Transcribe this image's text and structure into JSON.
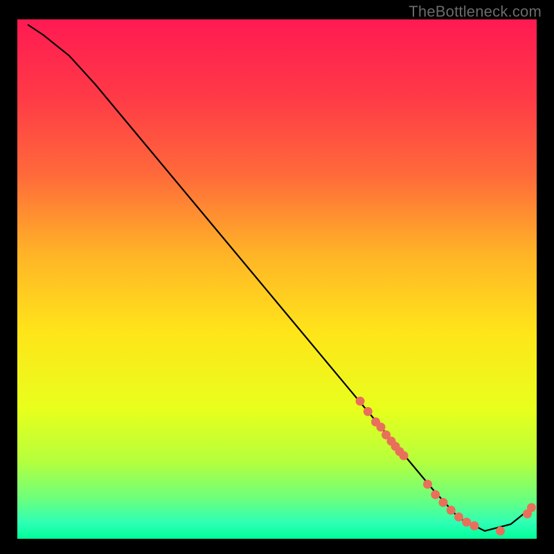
{
  "watermark": "TheBottleneck.com",
  "chart_data": {
    "type": "line",
    "title": "",
    "xlabel": "",
    "ylabel": "",
    "xlim": [
      0,
      100
    ],
    "ylim": [
      0,
      100
    ],
    "gradient_stops": [
      {
        "offset": 0.0,
        "color": "#ff1a52"
      },
      {
        "offset": 0.15,
        "color": "#ff3a47"
      },
      {
        "offset": 0.3,
        "color": "#ff6a3a"
      },
      {
        "offset": 0.45,
        "color": "#ffb327"
      },
      {
        "offset": 0.6,
        "color": "#ffe41a"
      },
      {
        "offset": 0.75,
        "color": "#e8ff1c"
      },
      {
        "offset": 0.85,
        "color": "#b6ff3c"
      },
      {
        "offset": 0.92,
        "color": "#6fff7a"
      },
      {
        "offset": 0.97,
        "color": "#2dffb5"
      },
      {
        "offset": 1.0,
        "color": "#00ff99"
      }
    ],
    "series": [
      {
        "name": "bottleneck-curve",
        "x": [
          2,
          5,
          10,
          15,
          20,
          25,
          30,
          35,
          40,
          45,
          50,
          55,
          60,
          65,
          70,
          75,
          80,
          85,
          90,
          95,
          99
        ],
        "y": [
          99,
          97,
          93,
          87.5,
          81.5,
          75.5,
          69.5,
          63.5,
          57.5,
          51.5,
          45.5,
          39.5,
          33.5,
          27.5,
          21.5,
          15.5,
          9.5,
          4.0,
          1.5,
          2.8,
          6.0
        ],
        "stroke": "#000000"
      }
    ],
    "marker_points": {
      "name": "highlight-markers",
      "color": "#e96f5b",
      "x": [
        66,
        67.5,
        69,
        70,
        71,
        72,
        72.8,
        73.6,
        74.4,
        79,
        80.5,
        82,
        83.5,
        85,
        86.5,
        88,
        93,
        98.2,
        99
      ],
      "y": [
        26.5,
        24.5,
        22.5,
        21.5,
        20.0,
        18.8,
        17.8,
        16.8,
        16.0,
        10.5,
        8.5,
        7.0,
        5.5,
        4.2,
        3.2,
        2.5,
        1.5,
        4.8,
        6.0
      ]
    }
  }
}
